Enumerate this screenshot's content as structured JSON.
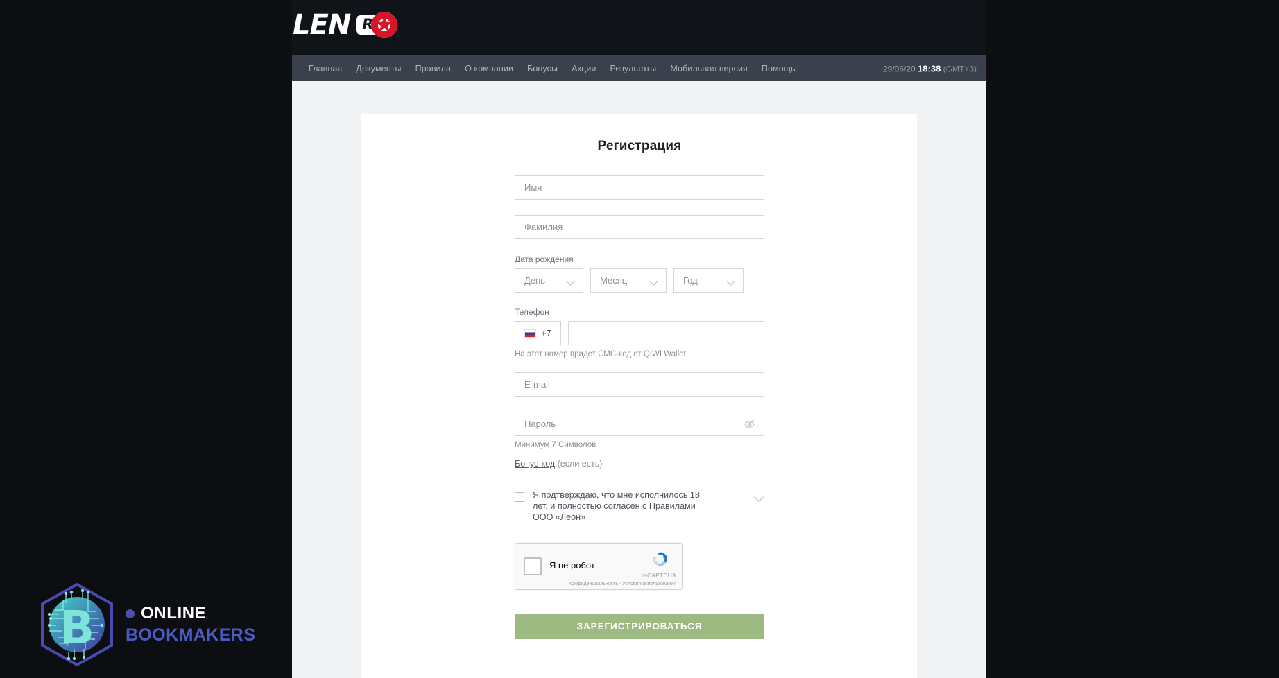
{
  "brand": {
    "logo_leon": "LEN",
    "logo_letter_o": "O",
    "logo_ru": "RU",
    "logo_full": "LEON.RU"
  },
  "nav": {
    "items": [
      {
        "label": "Главная"
      },
      {
        "label": "Документы"
      },
      {
        "label": "Правила"
      },
      {
        "label": "О компании"
      },
      {
        "label": "Бонусы"
      },
      {
        "label": "Акции"
      },
      {
        "label": "Результаты"
      },
      {
        "label": "Мобильная версия"
      },
      {
        "label": "Помощь"
      }
    ],
    "datetime": {
      "date": "29/06/20",
      "time": "18:38",
      "timezone": "(GMT+3)"
    }
  },
  "form": {
    "title": "Регистрация",
    "first_name": {
      "placeholder": "Имя",
      "value": ""
    },
    "last_name": {
      "placeholder": "Фамилия",
      "value": ""
    },
    "dob": {
      "label": "Дата рождения",
      "day": {
        "placeholder": "День",
        "value": ""
      },
      "month": {
        "placeholder": "Месяц",
        "value": ""
      },
      "year": {
        "placeholder": "Год",
        "value": ""
      }
    },
    "phone": {
      "label": "Телефон",
      "country_code": "+7",
      "flag": "ru-flag-icon",
      "value": "",
      "hint": "На этот номер придет СМС-код от QIWI Wallet"
    },
    "email": {
      "placeholder": "E-mail",
      "value": ""
    },
    "password": {
      "placeholder": "Пароль",
      "value": "",
      "toggle_icon": "eye-off-icon",
      "hint": "Минимум 7 Символов"
    },
    "bonus": {
      "link_label": "Бонус-код",
      "suffix": "(если есть)"
    },
    "agreement": {
      "checked": false,
      "text": "Я подтверждаю, что мне исполнилось 18 лет, и полностью согласен с Правилами ООО «Леон»",
      "expand_icon": "chevron-down-icon"
    },
    "recaptcha": {
      "label": "Я не робот",
      "brand": "reCAPTCHA",
      "privacy": "Конфиденциальность",
      "separator": "-",
      "terms": "Условия использования",
      "checked": false
    },
    "submit_label": "ЗАРЕГИСТРИРОВАТЬСЯ"
  },
  "watermark": {
    "letter": "B",
    "line1": "ONLINE",
    "line2": "BOOKMAKERS"
  },
  "colors": {
    "header_bg": "#101318",
    "navbar_bg": "#3b414c",
    "page_bg": "#f1f3f5",
    "card_bg": "#ffffff",
    "accent_red": "#d8132a",
    "submit_green": "#9cba81",
    "watermark_blue": "#4a5bc4"
  }
}
